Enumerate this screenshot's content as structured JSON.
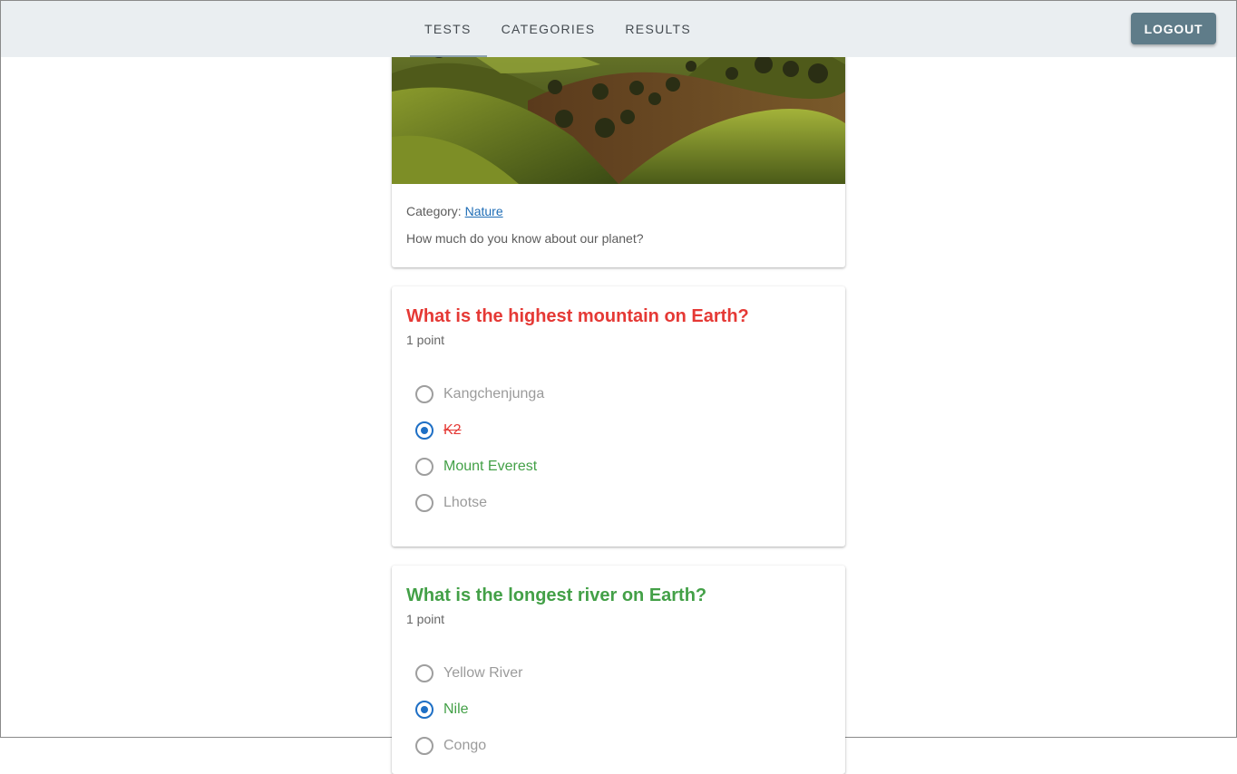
{
  "nav": {
    "tabs": [
      "TESTS",
      "CATEGORIES",
      "RESULTS"
    ],
    "active_tab": "TESTS",
    "logout_label": "LOGOUT"
  },
  "test": {
    "category_label": "Category:",
    "category_link": "Nature",
    "description": "How much do you know about our planet?"
  },
  "questions": [
    {
      "title": "What is the highest mountain on Earth?",
      "points": "1 point",
      "result": "incorrect",
      "options": [
        {
          "label": "Kangchenjunga",
          "selected": false,
          "state": "neutral"
        },
        {
          "label": "K2",
          "selected": true,
          "state": "wrong"
        },
        {
          "label": "Mount Everest",
          "selected": false,
          "state": "correct"
        },
        {
          "label": "Lhotse",
          "selected": false,
          "state": "neutral"
        }
      ]
    },
    {
      "title": "What is the longest river on Earth?",
      "points": "1 point",
      "result": "correct",
      "options": [
        {
          "label": "Yellow River",
          "selected": false,
          "state": "neutral"
        },
        {
          "label": "Nile",
          "selected": true,
          "state": "correct"
        },
        {
          "label": "Congo",
          "selected": false,
          "state": "neutral"
        }
      ]
    }
  ],
  "colors": {
    "accent": "#1e6fc5",
    "correct": "#43a047",
    "wrong": "#e53935",
    "logout_bg": "#5f7c89",
    "topbar_bg": "#eaeef1"
  }
}
